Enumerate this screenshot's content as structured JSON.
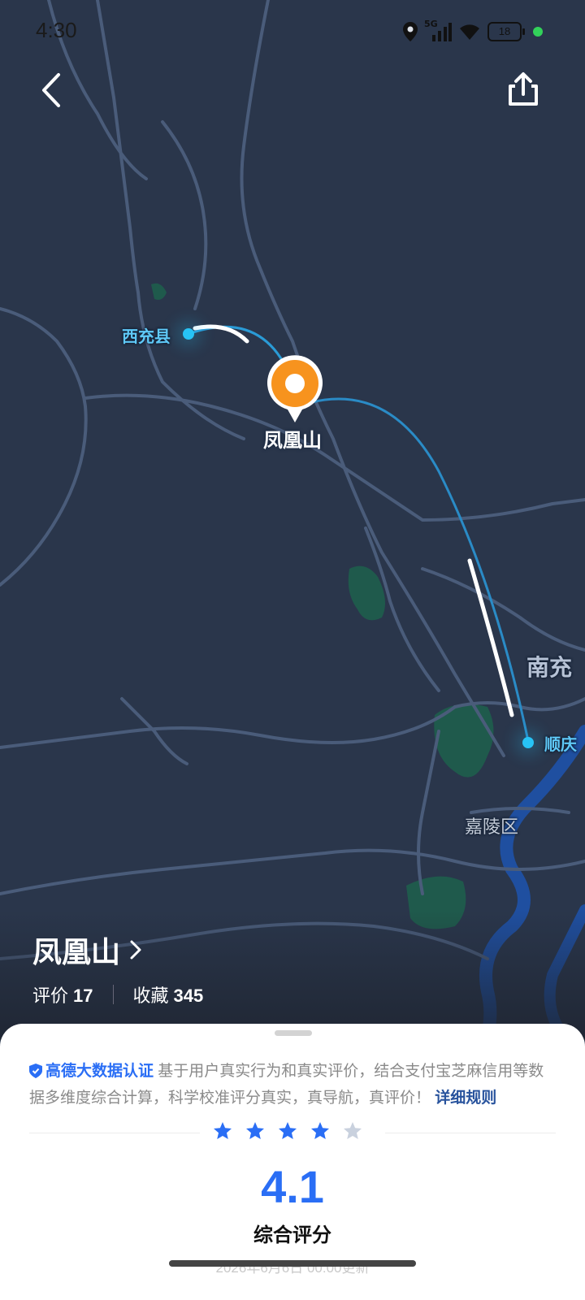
{
  "status_bar": {
    "time": "4:30",
    "network": "5G",
    "battery": "18"
  },
  "map": {
    "places": {
      "xichong": "西充县",
      "nanchong": "南充",
      "shunqing": "顺庆",
      "jialing": "嘉陵区"
    },
    "pin_label": "凤凰山"
  },
  "place": {
    "name": "凤凰山",
    "reviews_label": "评价",
    "reviews_count": "17",
    "favorites_label": "收藏",
    "favorites_count": "345"
  },
  "rating_sheet": {
    "badge": "高德大数据认证",
    "description": "基于用户真实行为和真实评价，结合支付宝芝麻信用等数据多维度综合计算，科学校准评分真实，真导航，真评价！",
    "rule_link": "详细规则",
    "stars_filled": 4,
    "stars_total": 5,
    "score": "4.1",
    "score_label": "综合评分",
    "updated": "2026年6月6日 00:00更新"
  },
  "colors": {
    "accent": "#2a6ef5",
    "map_bg": "#2a364b",
    "route": "#27c3f5",
    "pin": "#f7931e"
  }
}
